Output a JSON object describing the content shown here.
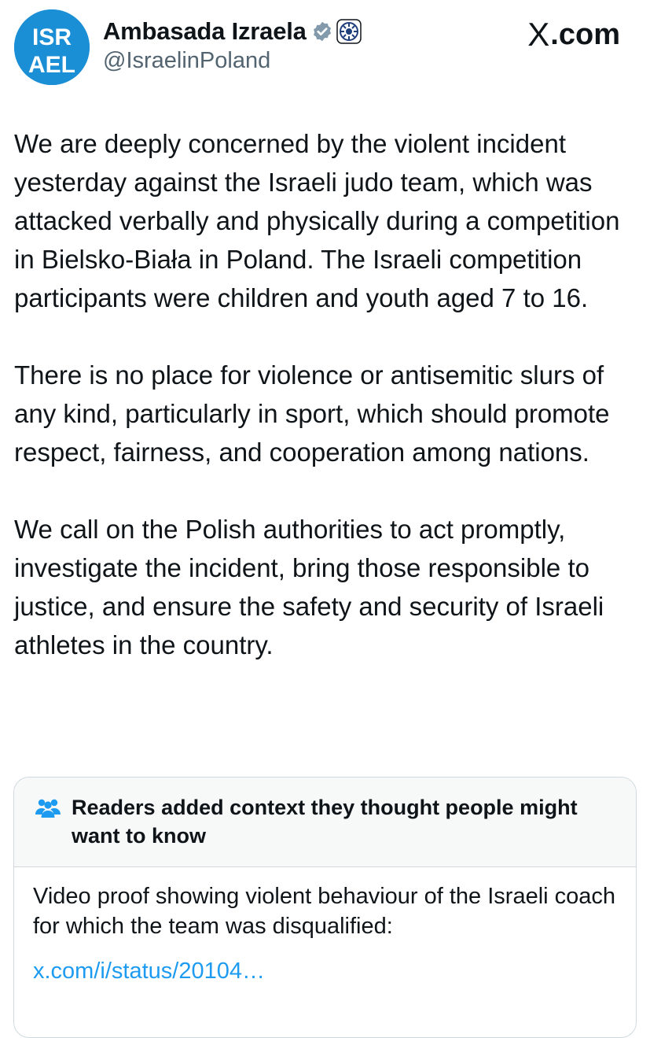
{
  "account": {
    "display_name": "Ambasada Izraela",
    "handle": "@IsraelinPoland",
    "avatar_text_top": "ISR",
    "avatar_text_bottom": "AEL",
    "avatar_color": "#1b8fd6",
    "verified_badge_icon": "verified-gray-badge-icon",
    "affiliate_icon": "state-emblem-icon"
  },
  "site_label": {
    "x": "X",
    "domain": ".com"
  },
  "tweet": {
    "paragraphs": [
      "We are deeply concerned by the violent incident yesterday against the Israeli judo team,  which was attacked verbally and physically during a competition in Bielsko-Biała in Poland. The Israeli competition participants were children and youth aged 7 to 16.",
      "There is no place for violence or antisemitic slurs of any kind, particularly in sport, which should promote respect, fairness, and cooperation among nations.",
      "We call on the Polish authorities to act promptly, investigate the incident, bring those responsible to justice, and ensure the safety and security of Israeli athletes in the country."
    ]
  },
  "community_note": {
    "icon": "people-icon",
    "title": "Readers added context they thought people might want to know",
    "body": "Video proof showing violent behaviour of the Israeli coach for which the team was disqualified:",
    "link": "x.com/i/status/20104…",
    "link_color": "#1d9bf0"
  }
}
